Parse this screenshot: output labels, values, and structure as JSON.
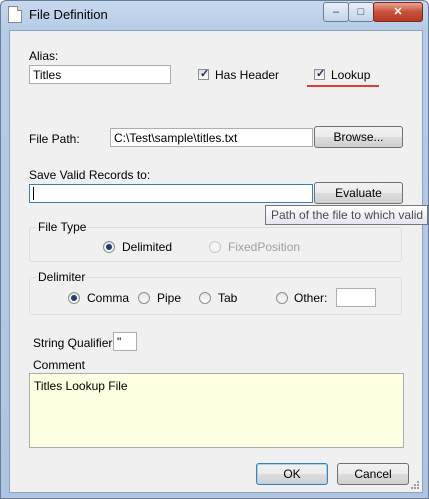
{
  "window": {
    "title": "File Definition",
    "minimize_glyph": "–",
    "maximize_glyph": "□",
    "close_glyph": "✕"
  },
  "alias": {
    "label": "Alias:",
    "value": "Titles"
  },
  "has_header": {
    "label": "Has Header",
    "checked": true
  },
  "lookup": {
    "label": "Lookup",
    "checked": true
  },
  "file_path": {
    "label": "File Path:",
    "value": "C:\\Test\\sample\\titles.txt",
    "browse_label": "Browse..."
  },
  "save_valid": {
    "label": "Save Valid Records to:",
    "value": "",
    "evaluate_label": "Evaluate"
  },
  "tooltip": {
    "text": "Path of the file to which valid"
  },
  "file_type": {
    "title": "File Type",
    "options": [
      {
        "label": "Delimited",
        "selected": true,
        "enabled": true
      },
      {
        "label": "FixedPosition",
        "selected": false,
        "enabled": false
      }
    ]
  },
  "delimiter": {
    "title": "Delimiter",
    "options": [
      {
        "label": "Comma",
        "selected": true
      },
      {
        "label": "Pipe",
        "selected": false
      },
      {
        "label": "Tab",
        "selected": false
      },
      {
        "label": "Other:",
        "selected": false
      }
    ],
    "other_value": ""
  },
  "string_qualifier": {
    "label": "String Qualifier",
    "value": "\""
  },
  "comment": {
    "label": "Comment",
    "value": "Titles Lookup File"
  },
  "buttons": {
    "ok": "OK",
    "cancel": "Cancel"
  },
  "colors": {
    "comment_bg": "#ffffe1",
    "lookup_underline": "#d6403a",
    "titlebar": "#b6cbe6"
  }
}
